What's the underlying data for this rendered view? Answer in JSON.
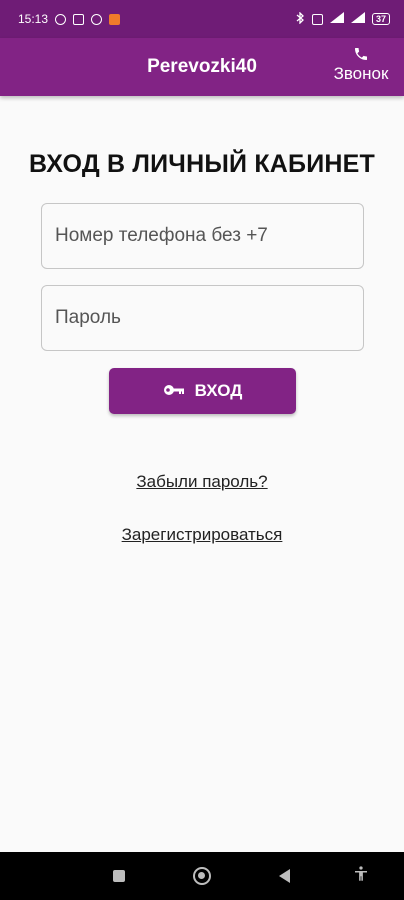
{
  "status_bar": {
    "time": "15:13",
    "battery": "37"
  },
  "app_bar": {
    "title": "Perevozki40",
    "call_label": "Звонок",
    "color": "#822385"
  },
  "login": {
    "heading": "ВХОД В ЛИЧНЫЙ КАБИНЕТ",
    "phone_placeholder": "Номер телефона без +7",
    "password_placeholder": "Пароль",
    "submit_label": "ВХОД",
    "submit_icon": "key-icon",
    "forgot_link": "Забыли пароль?",
    "register_link": "Зарегистрироваться"
  },
  "nav_bar": {
    "icons": [
      "recents-icon",
      "home-icon",
      "back-icon",
      "accessibility-icon"
    ]
  }
}
